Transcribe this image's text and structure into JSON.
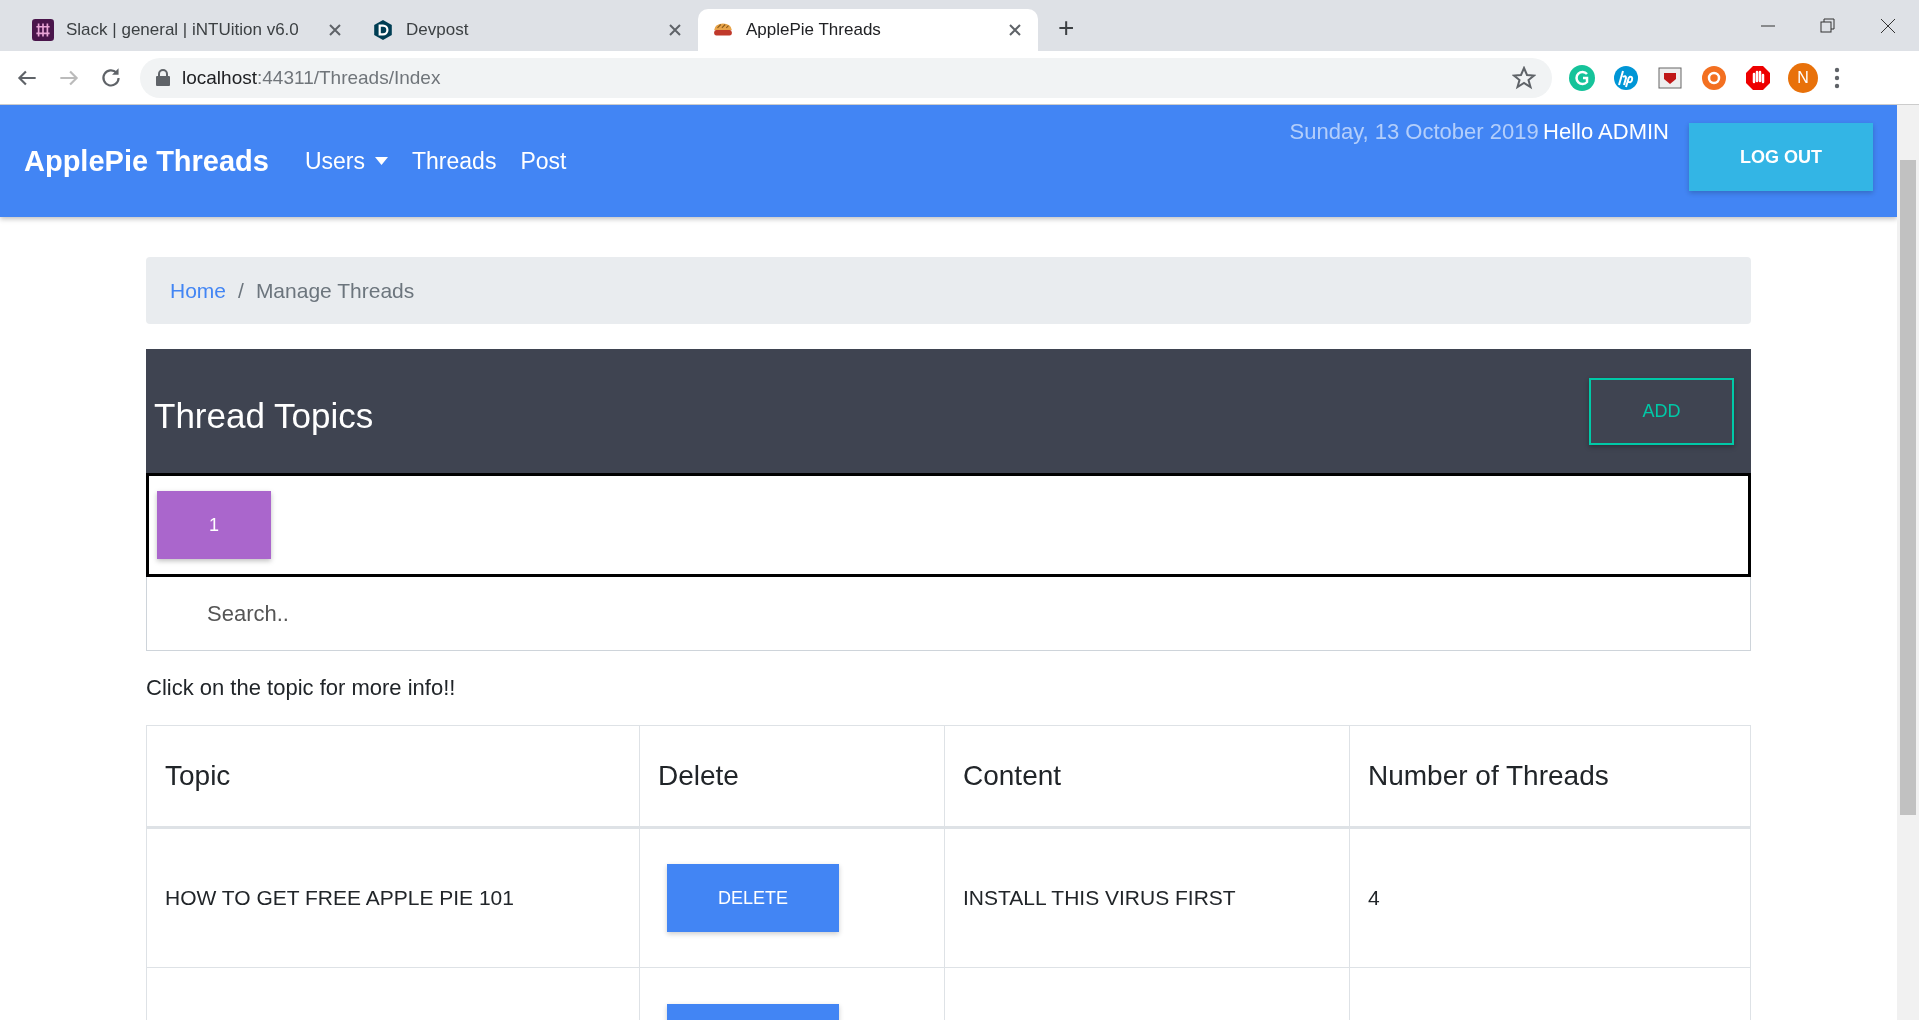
{
  "browser": {
    "tabs": [
      {
        "title": "Slack | general | iNTUition v6.0",
        "selected": false
      },
      {
        "title": "Devpost",
        "selected": false
      },
      {
        "title": "ApplePie Threads",
        "selected": true
      }
    ],
    "new_tab": "+",
    "url_host": "localhost",
    "url_path": ":44311/Threads/Index",
    "profile_initial": "N"
  },
  "navbar": {
    "brand": "ApplePie Threads",
    "links": [
      {
        "label": "Users",
        "dropdown": true
      },
      {
        "label": "Threads",
        "dropdown": false
      },
      {
        "label": "Post",
        "dropdown": false
      }
    ],
    "date": "Sunday, 13 October 2019",
    "greeting": "Hello ADMIN",
    "logout": "LOG OUT"
  },
  "breadcrumb": {
    "separator": "/",
    "items": [
      {
        "label": "Home",
        "link": true
      },
      {
        "label": "Manage Threads",
        "link": false
      }
    ]
  },
  "panel": {
    "title": "Thread Topics",
    "add": "ADD",
    "pages": [
      {
        "label": "1",
        "selected": true
      }
    ]
  },
  "search": {
    "placeholder": "Search.."
  },
  "hint": "Click on the topic for more info!!",
  "table": {
    "columns": [
      "Topic",
      "Delete",
      "Content",
      "Number of Threads"
    ],
    "rows": [
      {
        "kind": "full",
        "topic": "HOW TO GET FREE APPLE PIE 101",
        "delete": "DELETE",
        "content": "INSTALL THIS VIRUS FIRST",
        "count": "4"
      },
      {
        "kind": "partial"
      }
    ]
  }
}
